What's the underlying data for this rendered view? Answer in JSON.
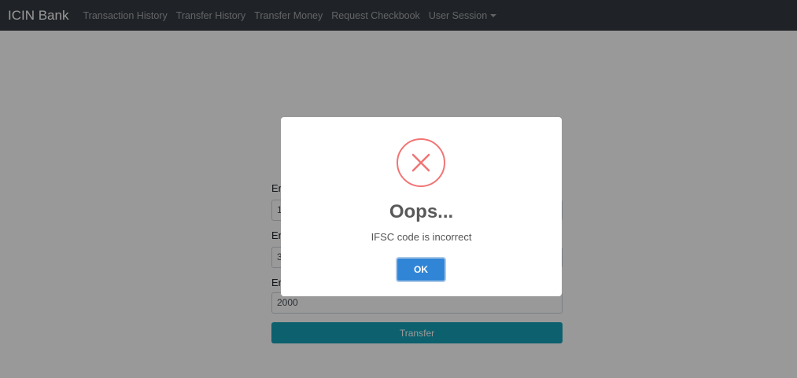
{
  "navbar": {
    "brand": "ICIN Bank",
    "links": [
      "Transaction History",
      "Transfer History",
      "Transfer Money",
      "Request Checkbook",
      "User Session"
    ]
  },
  "form": {
    "field1_label": "Enter",
    "field1_value": "1",
    "field2_label": "Enter",
    "field2_value": "3",
    "field3_label": "Enter",
    "field3_value": "2000",
    "submit_label": "Transfer"
  },
  "modal": {
    "icon": "error-x-icon",
    "title": "Oops...",
    "message": "IFSC code is incorrect",
    "confirm_label": "OK"
  },
  "colors": {
    "navbar_bg": "#343a40",
    "error_red": "#f27474",
    "confirm_blue": "#3085d6",
    "transfer_teal": "#17a2b8"
  }
}
